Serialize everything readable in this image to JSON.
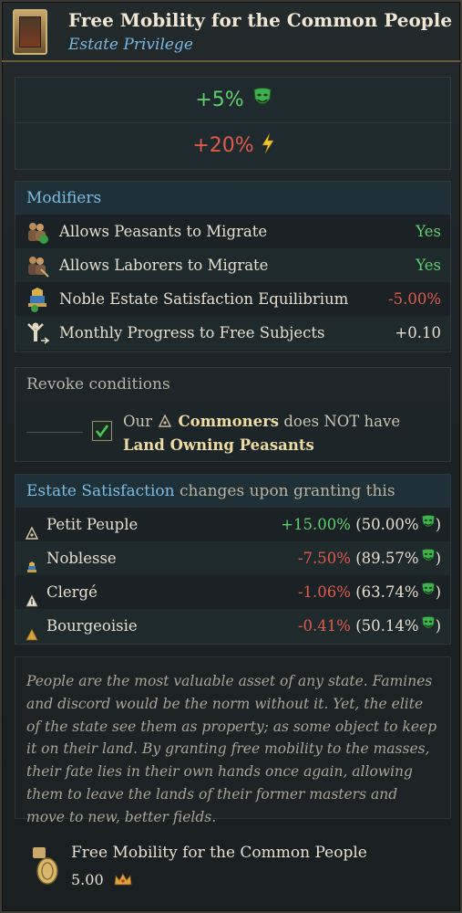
{
  "header": {
    "title": "Free Mobility for the Common People",
    "subtitle": "Estate Privilege",
    "icon": "privilege-painting-icon"
  },
  "effects": {
    "effect1": {
      "value": "+5%",
      "icon": "green-mask-icon",
      "color": "#5fcf6a"
    },
    "effect2": {
      "value": "+20%",
      "icon": "lightning-bolt-icon",
      "color": "#e15b4a"
    }
  },
  "modifiers": {
    "title": "Modifiers",
    "rows": [
      {
        "label": "Allows Peasants to Migrate",
        "value": "Yes",
        "icon": "peasants-migrate-icon"
      },
      {
        "label": "Allows Laborers to Migrate",
        "value": "Yes",
        "icon": "laborers-migrate-icon"
      },
      {
        "label": "Noble Estate Satisfaction Equilibrium",
        "value": "-5.00%",
        "icon": "noble-estate-icon"
      },
      {
        "label": "Monthly Progress to Free Subjects",
        "value": "+0.10",
        "icon": "free-subjects-icon"
      }
    ]
  },
  "revoke": {
    "title": "Revoke conditions",
    "condition": {
      "prefix": "Our",
      "estate": "Commoners",
      "middle": "does NOT have",
      "target": "Land Owning Peasants",
      "checked": true
    }
  },
  "satisfaction": {
    "title_bold": "Estate Satisfaction",
    "title_rest": "changes upon granting this Privilege:",
    "rows": [
      {
        "estate": "Petit Peuple",
        "change": "+15.00%",
        "base": "(50.00%",
        "close": ")",
        "icon": "commoners-estate-icon"
      },
      {
        "estate": "Noblesse",
        "change": "-7.50%",
        "base": "(89.57%",
        "close": ")",
        "icon": "nobility-estate-icon"
      },
      {
        "estate": "Clergé",
        "change": "-1.06%",
        "base": "(63.74%",
        "close": ")",
        "icon": "clergy-estate-icon"
      },
      {
        "estate": "Bourgeoisie",
        "change": "-0.41%",
        "base": "(50.14%",
        "close": ")",
        "icon": "burghers-estate-icon"
      }
    ]
  },
  "lore": "People are the most valuable asset of any state. Famines and discord would be the norm without it. Yet, the elite of the state see them as property; as some object to keep it on their land. By granting free mobility to the masses, their fate lies in their own hands once again, allowing them to leave the lands of their former masters and move to new, better fields.",
  "footer": {
    "title": "Free Mobility for the Common People",
    "cost": "5.00",
    "cost_icon": "crown-icon",
    "icon": "gold-coin-icon"
  },
  "colors": {
    "positive": "#5fcf6a",
    "negative": "#e15b4a",
    "accent_blue": "#7bbde6",
    "estate_name": "#f0dba4"
  }
}
